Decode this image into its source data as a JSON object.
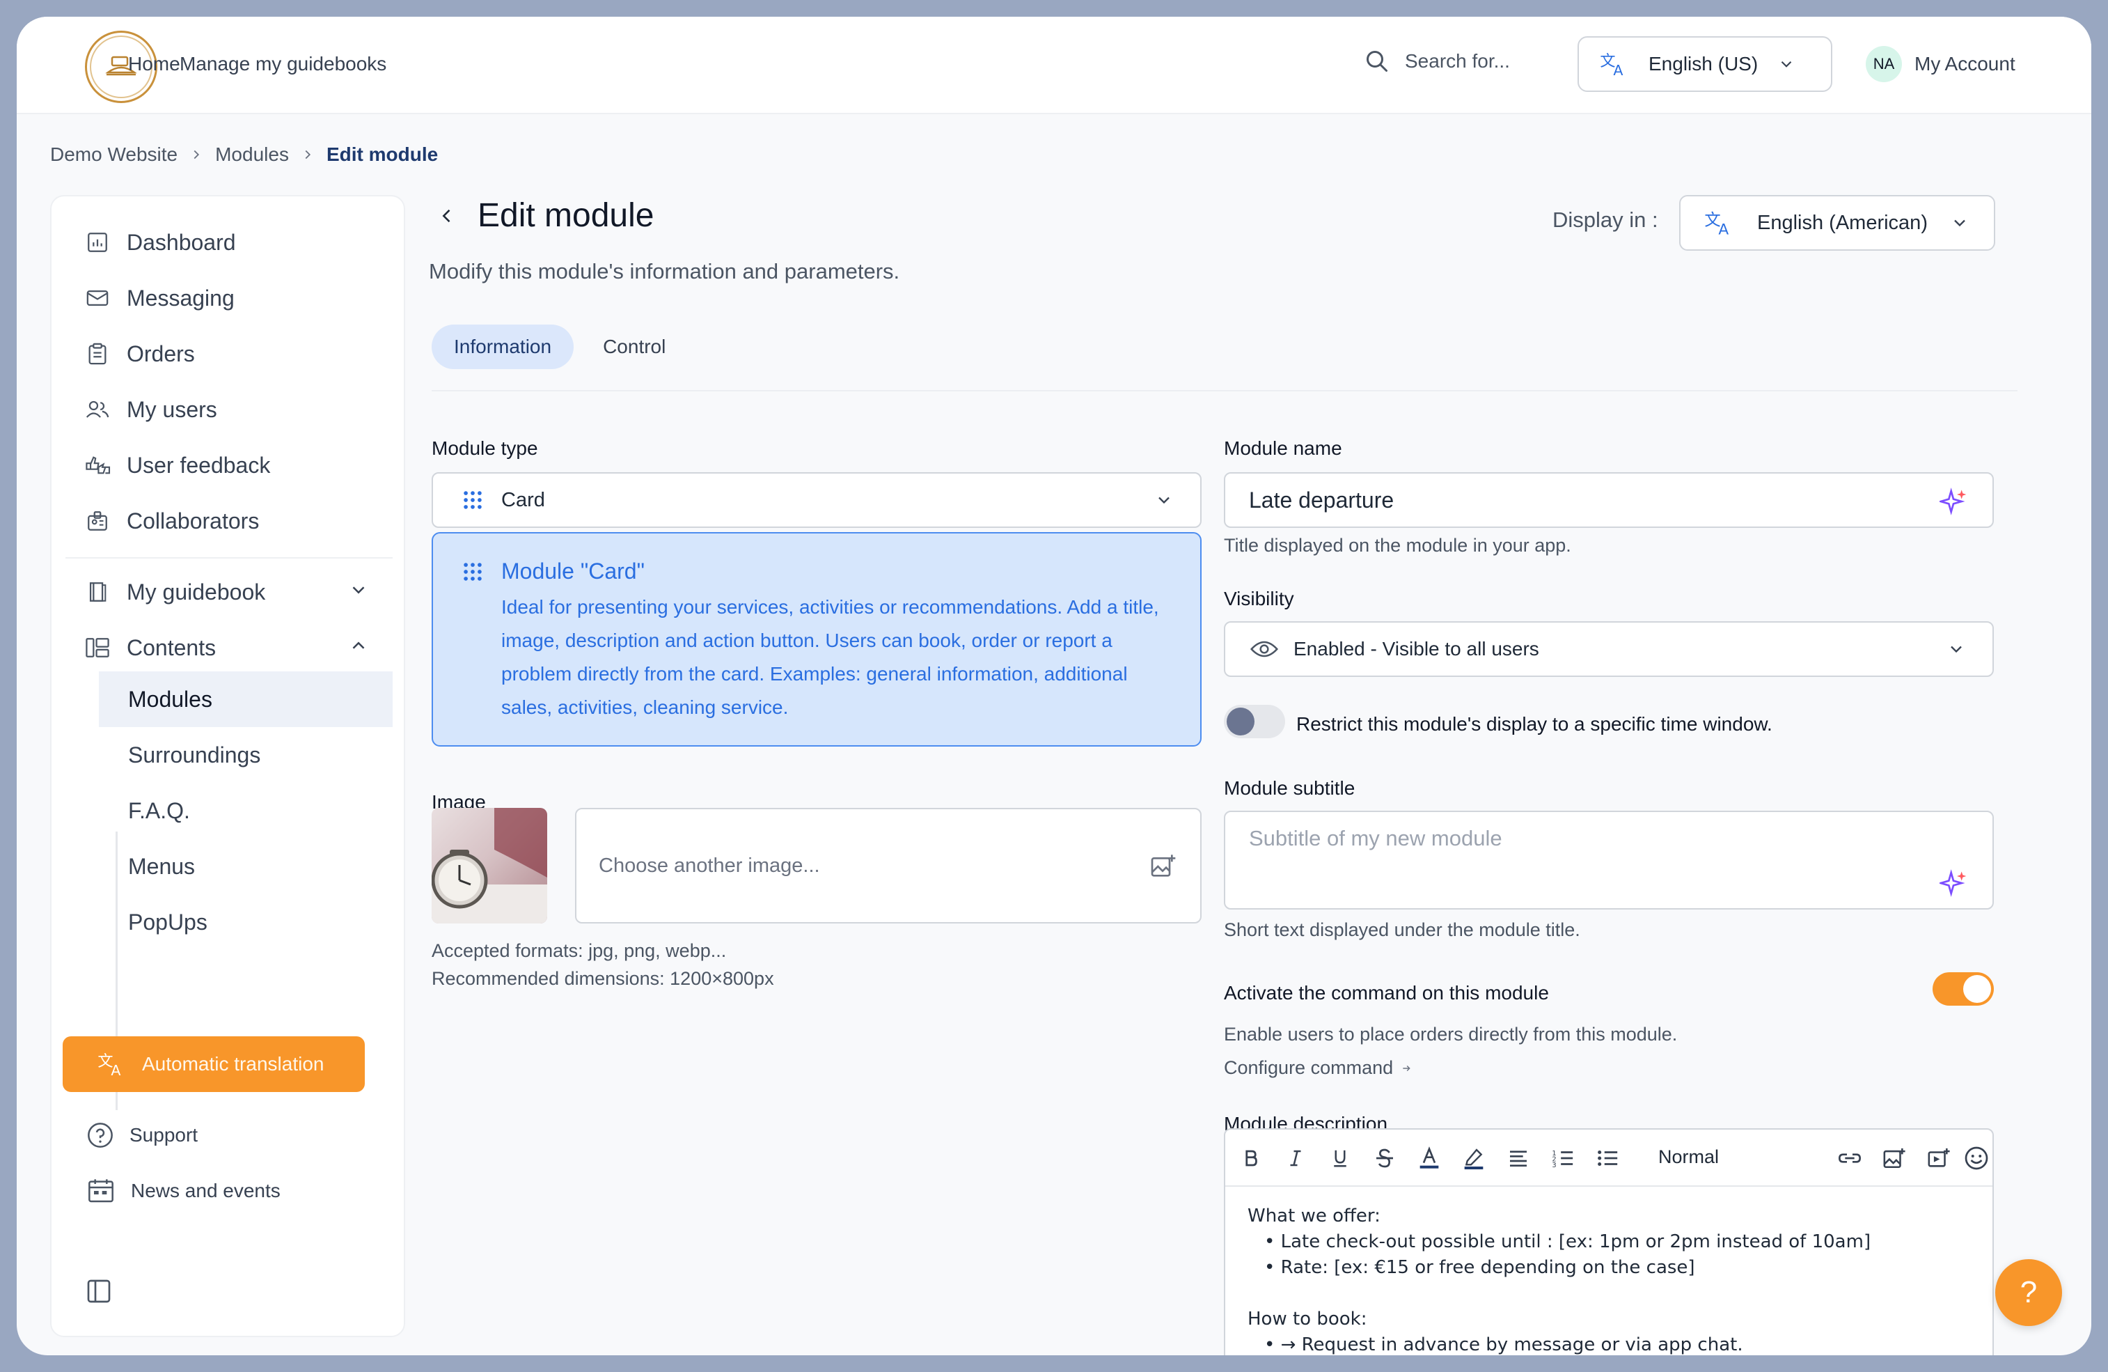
{
  "topbar": {
    "nav": [
      {
        "label": "Home"
      },
      {
        "label": "Manage my guidebooks"
      }
    ],
    "search_label": "Search for...",
    "language_label": "English (US)",
    "account_initials": "NA",
    "account_label": "My Account"
  },
  "breadcrumb": [
    "Demo Website",
    "Modules",
    "Edit module"
  ],
  "sidebar": {
    "items": [
      {
        "label": "Dashboard",
        "icon": "dashboard-icon"
      },
      {
        "label": "Messaging",
        "icon": "mail-icon"
      },
      {
        "label": "Orders",
        "icon": "clipboard-icon"
      },
      {
        "label": "My users",
        "icon": "users-icon"
      },
      {
        "label": "User feedback",
        "icon": "thumbs-icon"
      },
      {
        "label": "Collaborators",
        "icon": "id-badge-icon"
      },
      {
        "label": "My guidebook",
        "icon": "book-icon"
      },
      {
        "label": "Contents",
        "icon": "contents-icon"
      }
    ],
    "sub_items": [
      {
        "label": "Modules"
      },
      {
        "label": "Surroundings"
      },
      {
        "label": "F.A.Q."
      },
      {
        "label": "Menus"
      },
      {
        "label": "PopUps"
      }
    ],
    "auto_translate_label": "Automatic translation",
    "support_label": "Support",
    "news_label": "News and events"
  },
  "page": {
    "title": "Edit module",
    "subtitle": "Modify this module's information and parameters.",
    "display_in_label": "Display in :",
    "display_language": "English (American)",
    "tabs": [
      {
        "label": "Information"
      },
      {
        "label": "Control"
      }
    ]
  },
  "form": {
    "module_type_label": "Module type",
    "module_type_value": "Card",
    "info_title": "Module \"Card\"",
    "info_text": "Ideal for presenting your services, activities or recommendations. Add a title, image, description and action button. Users can book, order or report a problem directly from the card. Examples: general information, additional sales, activities, cleaning service.",
    "image_label": "Image",
    "image_placeholder": "Choose another image...",
    "image_formats": "Accepted formats: jpg, png, webp...",
    "image_dimensions": "Recommended dimensions: 1200×800px",
    "module_name_label": "Module name",
    "module_name_value": "Late departure",
    "module_name_hint": "Title displayed on the module in your app.",
    "visibility_label": "Visibility",
    "visibility_value": "Enabled - Visible to all users",
    "restrict_label": "Restrict this module's display to a specific time window.",
    "restrict_enabled": false,
    "subtitle_label": "Module subtitle",
    "subtitle_placeholder": "Subtitle of my new module",
    "subtitle_hint": "Short text displayed under the module title.",
    "command_label": "Activate the command on this module",
    "command_enabled": true,
    "command_hint": "Enable users to place orders directly from this module.",
    "configure_label": "Configure command",
    "description_label": "Module description",
    "editor_style": "Normal",
    "description_lines": [
      "What we offer:",
      "• Late check-out possible until : [ex: 1pm or 2pm instead of 10am]",
      "• Rate: [ex: €15 or free depending on the case]",
      "",
      "How to book:",
      "• → Request in advance by message or via app chat."
    ]
  },
  "colors": {
    "accent_orange": "#f8962a",
    "info_blue": "#2a6ee0",
    "navy": "#1e3a6e"
  }
}
